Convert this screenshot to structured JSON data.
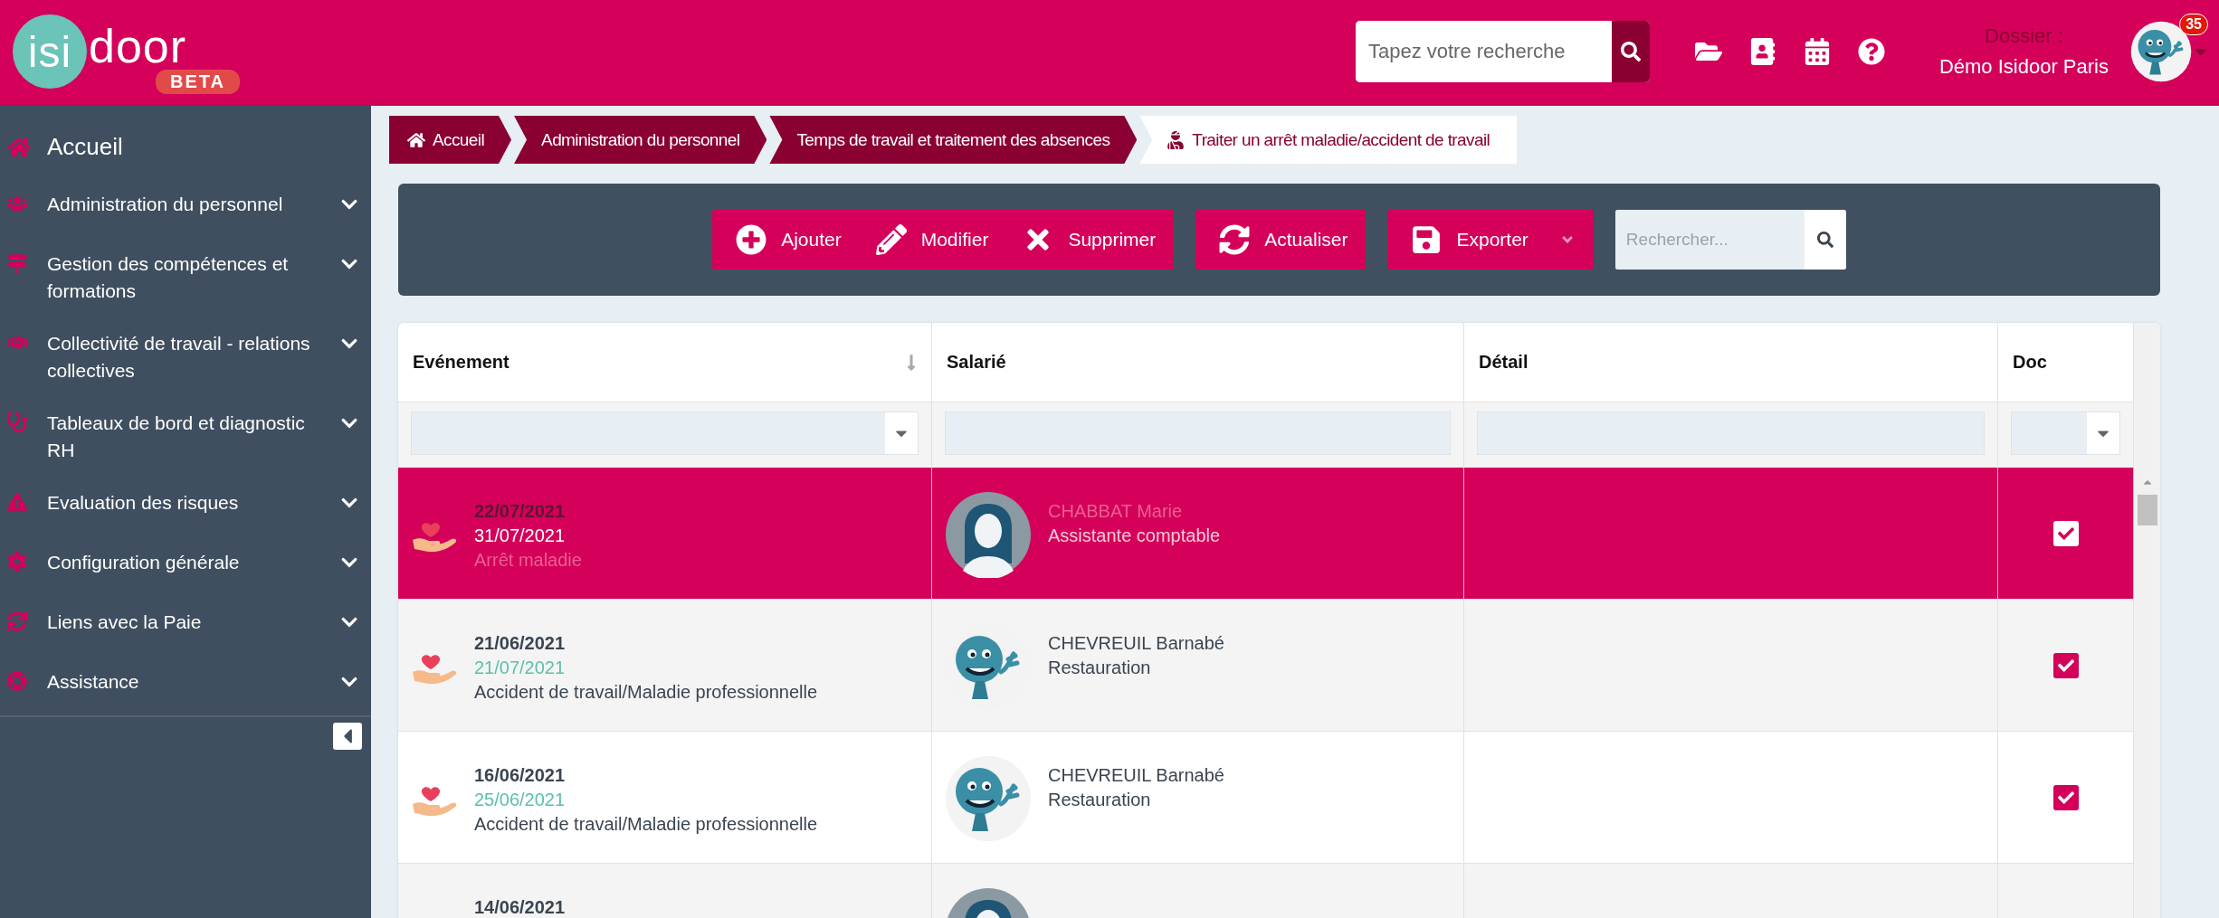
{
  "header": {
    "logo": {
      "mark": "isi",
      "text": "door",
      "badge": "BETA"
    },
    "search": {
      "placeholder": "Tapez votre recherche"
    },
    "dossier_label": "Dossier :",
    "dossier_name": "Démo Isidoor Paris",
    "notifications": "35"
  },
  "sidebar": {
    "items": [
      {
        "label": "Accueil",
        "kind": "link"
      },
      {
        "label": "Administration du personnel",
        "kind": "group"
      },
      {
        "label": "Gestion des compétences et formations",
        "kind": "group"
      },
      {
        "label": "Collectivité de travail - relations collectives",
        "kind": "group"
      },
      {
        "label": "Tableaux de bord et diagnostic RH",
        "kind": "group"
      },
      {
        "label": "Evaluation des risques",
        "kind": "group"
      },
      {
        "label": "Configuration générale",
        "kind": "group"
      },
      {
        "label": "Liens avec la Paie",
        "kind": "group"
      },
      {
        "label": "Assistance",
        "kind": "group"
      }
    ]
  },
  "breadcrumb": [
    {
      "label": "Accueil",
      "current": false
    },
    {
      "label": "Administration du personnel",
      "current": false
    },
    {
      "label": "Temps de travail et traitement des absences",
      "current": false
    },
    {
      "label": "Traiter un arrêt maladie/accident de travail",
      "current": true
    }
  ],
  "toolbar": {
    "groups": [
      [
        {
          "label": "Ajouter",
          "menu": false
        },
        {
          "label": "Modifier",
          "menu": false
        },
        {
          "label": "Supprimer",
          "menu": false
        }
      ],
      [
        {
          "label": "Actualiser",
          "menu": false
        }
      ],
      [
        {
          "label": "Exporter",
          "menu": true
        }
      ]
    ],
    "search": {
      "placeholder": "Rechercher..."
    }
  },
  "table": {
    "columns": [
      {
        "label": "Evénement",
        "sorted": true,
        "kind": "select"
      },
      {
        "label": "Salarié",
        "sorted": false,
        "kind": "text"
      },
      {
        "label": "Détail",
        "sorted": false,
        "kind": "text"
      },
      {
        "label": "Doc",
        "sorted": false,
        "kind": "select"
      }
    ],
    "rows": [
      {
        "selected": true,
        "kind": "person",
        "start": "22/07/2021",
        "end": "31/07/2021",
        "type": "Arrêt maladie",
        "name": "CHABBAT Marie",
        "job": "Assistante comptable",
        "doc": true
      },
      {
        "selected": false,
        "kind": "mascot",
        "start": "21/06/2021",
        "end": "21/07/2021",
        "type": "Accident de travail/Maladie professionnelle",
        "name": "CHEVREUIL Barnabé",
        "job": "Restauration",
        "doc": true
      },
      {
        "selected": false,
        "kind": "mascot",
        "start": "16/06/2021",
        "end": "25/06/2021",
        "type": "Accident de travail/Maladie professionnelle",
        "name": "CHEVREUIL Barnabé",
        "job": "Restauration",
        "doc": true
      },
      {
        "selected": false,
        "kind": "person",
        "start": "14/06/2021"
      }
    ]
  }
}
